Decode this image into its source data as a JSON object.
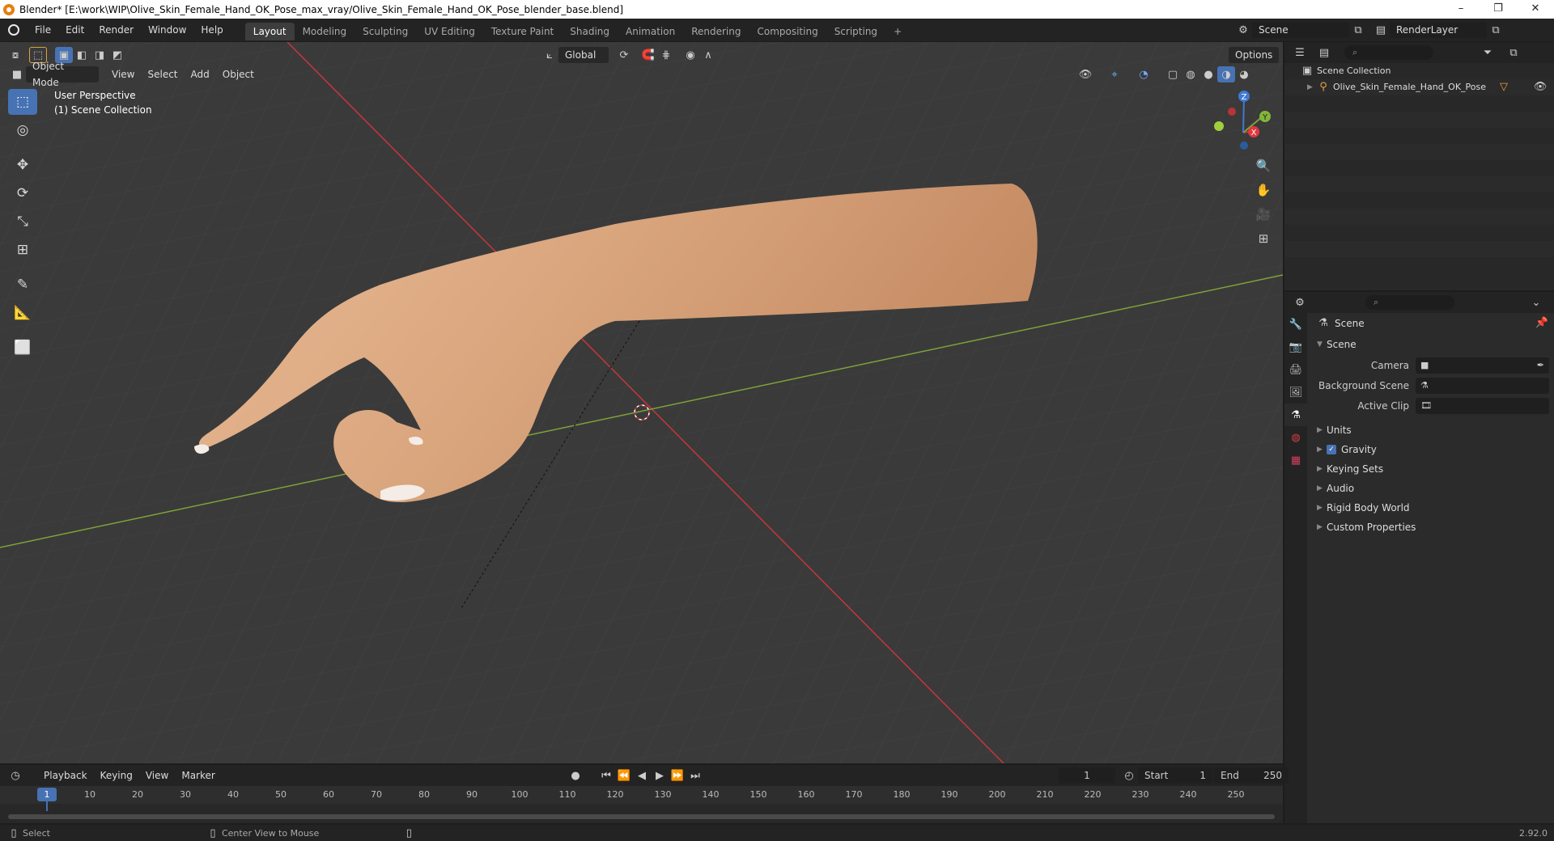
{
  "window": {
    "title": "Blender* [E:\\work\\WIP\\Olive_Skin_Female_Hand_OK_Pose_max_vray/Olive_Skin_Female_Hand_OK_Pose_blender_base.blend]",
    "controls": [
      "–",
      "❐",
      "✕"
    ]
  },
  "menu": [
    "File",
    "Edit",
    "Render",
    "Window",
    "Help"
  ],
  "workspaces": {
    "active": "Layout",
    "tabs": [
      "Layout",
      "Modeling",
      "Sculpting",
      "UV Editing",
      "Texture Paint",
      "Shading",
      "Animation",
      "Rendering",
      "Compositing",
      "Scripting"
    ],
    "add": "+"
  },
  "scene_selector": "Scene",
  "view_layer_selector": "RenderLayer",
  "viewport": {
    "mode": "Object Mode",
    "menus": [
      "View",
      "Select",
      "Add",
      "Object"
    ],
    "transform_orientation": "Global",
    "options": "Options",
    "info_line1": "User Perspective",
    "info_line2": "(1) Scene Collection",
    "gizmo": {
      "x": "X",
      "y": "Y",
      "z": "Z"
    },
    "colors": {
      "bg": "#3a3a3a",
      "grid": "#444444",
      "x_axis": "#c7363b",
      "y_axis": "#7ea33a",
      "skin": "#d9a57d"
    }
  },
  "outliner": {
    "root": "Scene Collection",
    "items": [
      "Olive_Skin_Female_Hand_OK_Pose"
    ]
  },
  "properties": {
    "context": "Scene",
    "panel": "Scene",
    "fields": [
      {
        "label": "Camera",
        "value": ""
      },
      {
        "label": "Background Scene",
        "value": ""
      },
      {
        "label": "Active Clip",
        "value": ""
      }
    ],
    "subpanels": [
      "Units",
      "Gravity",
      "Keying Sets",
      "Audio",
      "Rigid Body World",
      "Custom Properties"
    ]
  },
  "timeline": {
    "menus": [
      "Playback",
      "Keying",
      "View",
      "Marker"
    ],
    "current_frame": "1",
    "start_label": "Start",
    "start": "1",
    "end_label": "End",
    "end": "250",
    "ticks": [
      "1",
      "10",
      "20",
      "30",
      "40",
      "50",
      "60",
      "70",
      "80",
      "90",
      "100",
      "110",
      "120",
      "130",
      "140",
      "150",
      "160",
      "170",
      "180",
      "190",
      "200",
      "210",
      "220",
      "230",
      "240",
      "250"
    ]
  },
  "statusbar": {
    "select": "Select",
    "center": "Center View to Mouse",
    "version": "2.92.0"
  }
}
